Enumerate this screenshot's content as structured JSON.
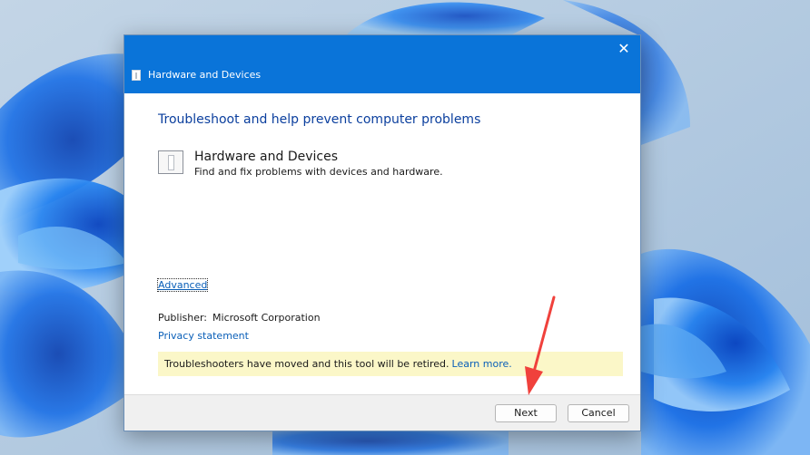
{
  "window": {
    "title": "Hardware and Devices",
    "close_glyph": "✕"
  },
  "main": {
    "heading": "Troubleshoot and help prevent computer problems",
    "tool": {
      "title": "Hardware and Devices",
      "description": "Find and fix problems with devices and hardware.",
      "icon": "troubleshooter-device-icon"
    },
    "advanced_label": "Advanced",
    "publisher_label": "Publisher:",
    "publisher_value": "Microsoft Corporation",
    "privacy_label": "Privacy statement",
    "notice_text": "Troubleshooters have moved and this tool will be retired.",
    "notice_link": "Learn more."
  },
  "footer": {
    "next_label": "Next",
    "cancel_label": "Cancel"
  },
  "colors": {
    "titlebar": "#0a74d9",
    "heading": "#0b3f9e",
    "link": "#0a5fb8",
    "notice_background": "#fbf7c8",
    "annotation_arrow": "#f0413c"
  }
}
